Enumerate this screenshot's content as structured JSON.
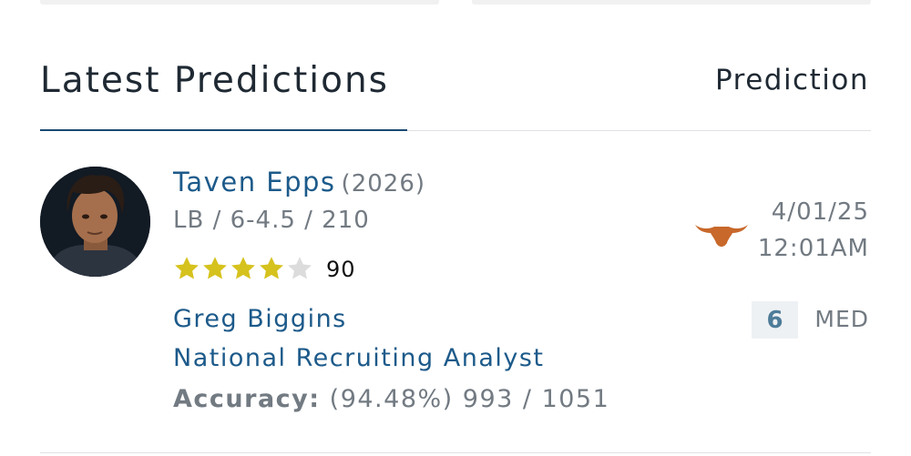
{
  "header": {
    "title": "Latest Predictions",
    "column_label": "Prediction"
  },
  "prediction": {
    "player": {
      "name": "Taven Epps",
      "class_year": "(2026)",
      "meta": "LB / 6-4.5 / 210",
      "stars": 4,
      "stars_max": 5,
      "rating": "90"
    },
    "analyst": {
      "name": "Greg Biggins",
      "title": "National Recruiting Analyst",
      "accuracy_label": "Accuracy:",
      "accuracy_value": "(94.48%) 993 / 1051"
    },
    "team_logo_icon": "longhorn-logo-icon",
    "team_color": "#c8682b",
    "date": "4/01/25",
    "time": "12:01AM",
    "confidence_value": "6",
    "confidence_label": "MED"
  },
  "colors": {
    "link_blue": "#1c5a8a",
    "star_filled": "#d6c21d",
    "star_empty": "#dcdcdc"
  }
}
